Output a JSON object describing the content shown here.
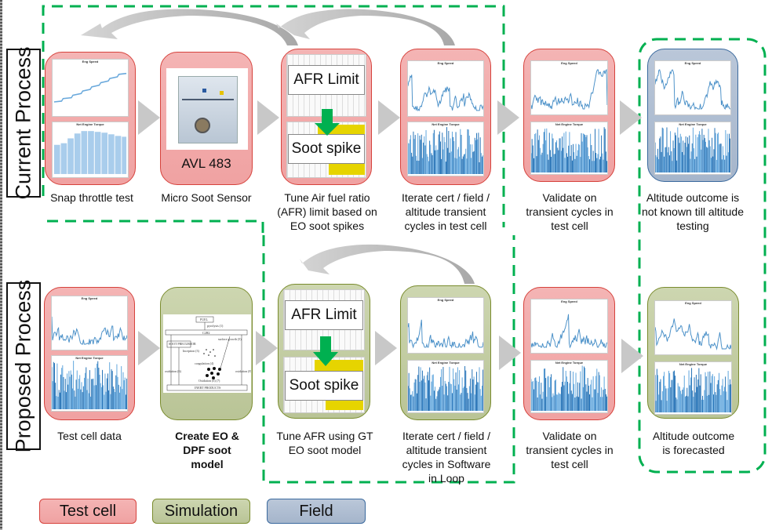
{
  "rows": {
    "current": {
      "label": "Current Process"
    },
    "proposed": {
      "label": "Proposed Process"
    }
  },
  "current_steps": [
    {
      "type": "Test cell",
      "caption": "Snap throttle test",
      "content": "snap-throttle-charts",
      "chart_titles": [
        "Eng Speed",
        "Net Engine Torque"
      ]
    },
    {
      "type": "Test cell",
      "caption": "Micro Soot Sensor",
      "content": "avl-device-photo",
      "inner_label": "AVL 483"
    },
    {
      "type": "Test cell",
      "caption": "Tune Air fuel ratio (AFR) limit based on EO soot spikes",
      "content": "afr-table",
      "inner_labels": [
        "AFR Limit",
        "Soot spike"
      ]
    },
    {
      "type": "Test cell",
      "caption": "Iterate cert / field / altitude transient cycles in test cell",
      "content": "transient-charts",
      "chart_titles": [
        "Eng Speed",
        "Net Engine Torque"
      ]
    },
    {
      "type": "Test cell",
      "caption": "Validate on transient cycles in test cell",
      "content": "transient-charts",
      "chart_titles": [
        "Eng Speed",
        "Net Engine Torque"
      ]
    },
    {
      "type": "Field",
      "caption": "Altitude outcome is not known till altitude testing",
      "content": "transient-charts",
      "chart_titles": [
        "Eng Speed",
        "Net Engine Torque"
      ]
    }
  ],
  "proposed_steps": [
    {
      "type": "Test cell",
      "caption": "Test cell data",
      "content": "transient-charts",
      "chart_titles": [
        "Eng Speed",
        "Net Engine Torque"
      ]
    },
    {
      "type": "Simulation",
      "caption": "Create EO & DPF soot model",
      "content": "soot-model-diagram",
      "diagram_labels": [
        "FUEL",
        "pyrolysis (1)",
        "C2H2",
        "(2)",
        "SOOT PRECURSOR",
        "surface growth (5)",
        "Inception (3)",
        "coagulation (4)",
        "oxidation (6)",
        "Oxidation (6) (7)",
        "oxidation (8)",
        "INERT PRODUCTS"
      ]
    },
    {
      "type": "Simulation",
      "caption": "Tune AFR using GT EO soot model",
      "content": "afr-table",
      "inner_labels": [
        "AFR Limit",
        "Soot spike"
      ]
    },
    {
      "type": "Simulation",
      "caption": "Iterate cert / field / altitude transient cycles in Software in Loop",
      "content": "transient-charts",
      "chart_titles": [
        "Eng Speed",
        "Net Engine Torque"
      ]
    },
    {
      "type": "Test cell",
      "caption": "Validate on transient cycles in test cell",
      "content": "transient-charts",
      "chart_titles": [
        "Eng Speed",
        "Net Engine Torque"
      ]
    },
    {
      "type": "Simulation",
      "caption": "Altitude outcome is forecasted",
      "content": "transient-charts",
      "chart_titles": [
        "Eng Speed",
        "Net Engine Torque"
      ]
    }
  ],
  "legend": [
    {
      "label": "Test cell",
      "color": "#f2aaaa"
    },
    {
      "label": "Simulation",
      "color": "#c4cda4"
    },
    {
      "label": "Field",
      "color": "#afbdd1"
    }
  ],
  "colors": {
    "test_cell_fill": "#f2aaaa",
    "test_cell_border": "#d6423c",
    "simulation_fill": "#c4cda4",
    "simulation_border": "#7a8c2e",
    "field_fill": "#afbdd1",
    "field_border": "#3b6a9e",
    "dashed_highlight": "#00b050",
    "feedback_arrow": "#b8b8b8",
    "down_arrow": "#00b050"
  }
}
